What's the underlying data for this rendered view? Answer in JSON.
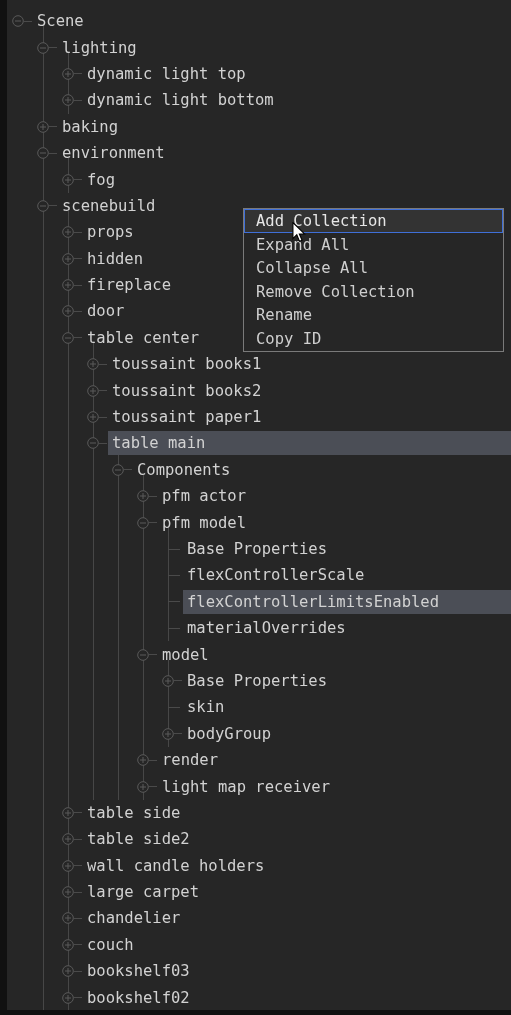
{
  "tree": [
    {
      "label": "Scene",
      "kind": "group",
      "expanded": true,
      "selected": false,
      "children": [
        {
          "label": "lighting",
          "kind": "group",
          "expanded": true,
          "selected": false,
          "children": [
            {
              "label": "dynamic light top",
              "kind": "group",
              "expanded": false,
              "selected": false
            },
            {
              "label": "dynamic light bottom",
              "kind": "group",
              "expanded": false,
              "selected": false
            }
          ]
        },
        {
          "label": "baking",
          "kind": "group",
          "expanded": false,
          "selected": false
        },
        {
          "label": "environment",
          "kind": "group",
          "expanded": true,
          "selected": false,
          "children": [
            {
              "label": "fog",
              "kind": "group",
              "expanded": false,
              "selected": false
            }
          ]
        },
        {
          "label": "scenebuild",
          "kind": "group",
          "expanded": true,
          "selected": false,
          "children": [
            {
              "label": "props",
              "kind": "group",
              "expanded": false,
              "selected": false
            },
            {
              "label": "hidden",
              "kind": "group",
              "expanded": false,
              "selected": false
            },
            {
              "label": "fireplace",
              "kind": "group",
              "expanded": false,
              "selected": false
            },
            {
              "label": "door",
              "kind": "group",
              "expanded": false,
              "selected": false
            },
            {
              "label": "table center",
              "kind": "group",
              "expanded": true,
              "selected": false,
              "children": [
                {
                  "label": "toussaint books1",
                  "kind": "group",
                  "expanded": false,
                  "selected": false
                },
                {
                  "label": "toussaint books2",
                  "kind": "group",
                  "expanded": false,
                  "selected": false
                },
                {
                  "label": "toussaint paper1",
                  "kind": "group",
                  "expanded": false,
                  "selected": false
                },
                {
                  "label": "table main",
                  "kind": "group",
                  "expanded": true,
                  "selected": true,
                  "children": [
                    {
                      "label": "Components",
                      "kind": "group",
                      "expanded": true,
                      "selected": false,
                      "children": [
                        {
                          "label": "pfm actor",
                          "kind": "group",
                          "expanded": false,
                          "selected": false
                        },
                        {
                          "label": "pfm model",
                          "kind": "group",
                          "expanded": true,
                          "selected": false,
                          "children": [
                            {
                              "label": "Base Properties",
                              "kind": "leaf",
                              "selected": false
                            },
                            {
                              "label": "flexControllerScale",
                              "kind": "leaf",
                              "selected": false
                            },
                            {
                              "label": "flexControllerLimitsEnabled",
                              "kind": "leaf",
                              "selected": true
                            },
                            {
                              "label": "materialOverrides",
                              "kind": "leaf",
                              "selected": false
                            }
                          ]
                        },
                        {
                          "label": "model",
                          "kind": "group",
                          "expanded": true,
                          "selected": false,
                          "children": [
                            {
                              "label": "Base Properties",
                              "kind": "group",
                              "expanded": false,
                              "selected": false
                            },
                            {
                              "label": "skin",
                              "kind": "leaf",
                              "selected": false
                            },
                            {
                              "label": "bodyGroup",
                              "kind": "group",
                              "expanded": false,
                              "selected": false
                            }
                          ]
                        },
                        {
                          "label": "render",
                          "kind": "group",
                          "expanded": false,
                          "selected": false
                        },
                        {
                          "label": "light map receiver",
                          "kind": "group",
                          "expanded": false,
                          "selected": false
                        }
                      ]
                    }
                  ]
                }
              ]
            },
            {
              "label": "table side",
              "kind": "group",
              "expanded": false,
              "selected": false
            },
            {
              "label": "table side2",
              "kind": "group",
              "expanded": false,
              "selected": false
            },
            {
              "label": "wall candle holders",
              "kind": "group",
              "expanded": false,
              "selected": false
            },
            {
              "label": "large carpet",
              "kind": "group",
              "expanded": false,
              "selected": false
            },
            {
              "label": "chandelier",
              "kind": "group",
              "expanded": false,
              "selected": false
            },
            {
              "label": "couch",
              "kind": "group",
              "expanded": false,
              "selected": false
            },
            {
              "label": "bookshelf03",
              "kind": "group",
              "expanded": false,
              "selected": false
            },
            {
              "label": "bookshelf02",
              "kind": "group",
              "expanded": false,
              "selected": false
            }
          ]
        }
      ]
    }
  ],
  "context_menu": {
    "items": [
      {
        "label": "Add Collection",
        "selected": true
      },
      {
        "label": "Expand All",
        "selected": false
      },
      {
        "label": "Collapse All",
        "selected": false
      },
      {
        "label": "Remove Collection",
        "selected": false
      },
      {
        "label": "Rename",
        "selected": false
      },
      {
        "label": "Copy ID",
        "selected": false
      }
    ]
  }
}
